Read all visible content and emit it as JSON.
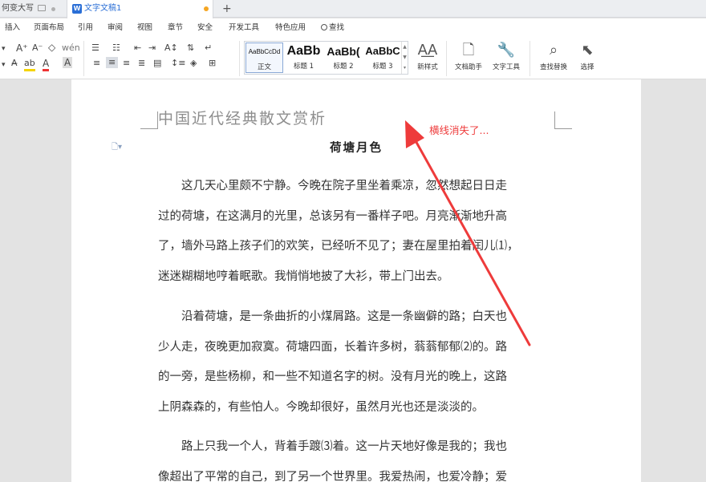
{
  "tabs": {
    "first_tab": "何变大写",
    "doc_tab_logo": "W",
    "doc_tab": "文字文稿1",
    "new_tab": "+"
  },
  "menu": {
    "insert": "插入",
    "page_layout": "页面布局",
    "references": "引用",
    "review": "审阅",
    "view": "视图",
    "section": "章节",
    "security": "安全",
    "developer": "开发工具",
    "features": "特色应用",
    "search": "查找"
  },
  "ribbon": {
    "styles": [
      {
        "sample": "AaBbCcDd",
        "caption": "正文"
      },
      {
        "sample": "AaBb",
        "caption": "标题 1"
      },
      {
        "sample": "AaBb(",
        "caption": "标题 2"
      },
      {
        "sample": "AaBbC",
        "caption": "标题 3"
      }
    ],
    "new_style": "新样式",
    "doc_assistant": "文档助手",
    "text_tools": "文字工具",
    "find_replace": "查找替换",
    "select": "选择"
  },
  "document": {
    "header_text": "中国近代经典散文赏析",
    "title": "荷塘月色",
    "paragraph1": [
      "　　这几天心里颇不宁静。今晚在院子里坐着乘凉，忽然想起日日走",
      "过的荷塘，在这满月的光里，总该另有一番样子吧。月亮渐渐地升高",
      "了，墙外马路上孩子们的欢笑，已经听不见了；妻在屋里拍着闰儿⑴，",
      "迷迷糊糊地哼着眠歌。我悄悄地披了大衫，带上门出去。"
    ],
    "paragraph2": [
      "　　沿着荷塘，是一条曲折的小煤屑路。这是一条幽僻的路；白天也",
      "少人走，夜晚更加寂寞。荷塘四面，长着许多树，蓊蓊郁郁⑵的。路",
      "的一旁，是些杨柳，和一些不知道名字的树。没有月光的晚上，这路",
      "上阴森森的，有些怕人。今晚却很好，虽然月光也还是淡淡的。"
    ],
    "paragraph3": [
      "　　路上只我一个人，背着手踱⑶着。这一片天地好像是我的；我也",
      "像超出了平常的自己，到了另一个世界里。我爱热闹，也爱冷静；爱"
    ]
  },
  "annotation": {
    "text": "横线消失了...",
    "color": "#ee3b3b"
  }
}
